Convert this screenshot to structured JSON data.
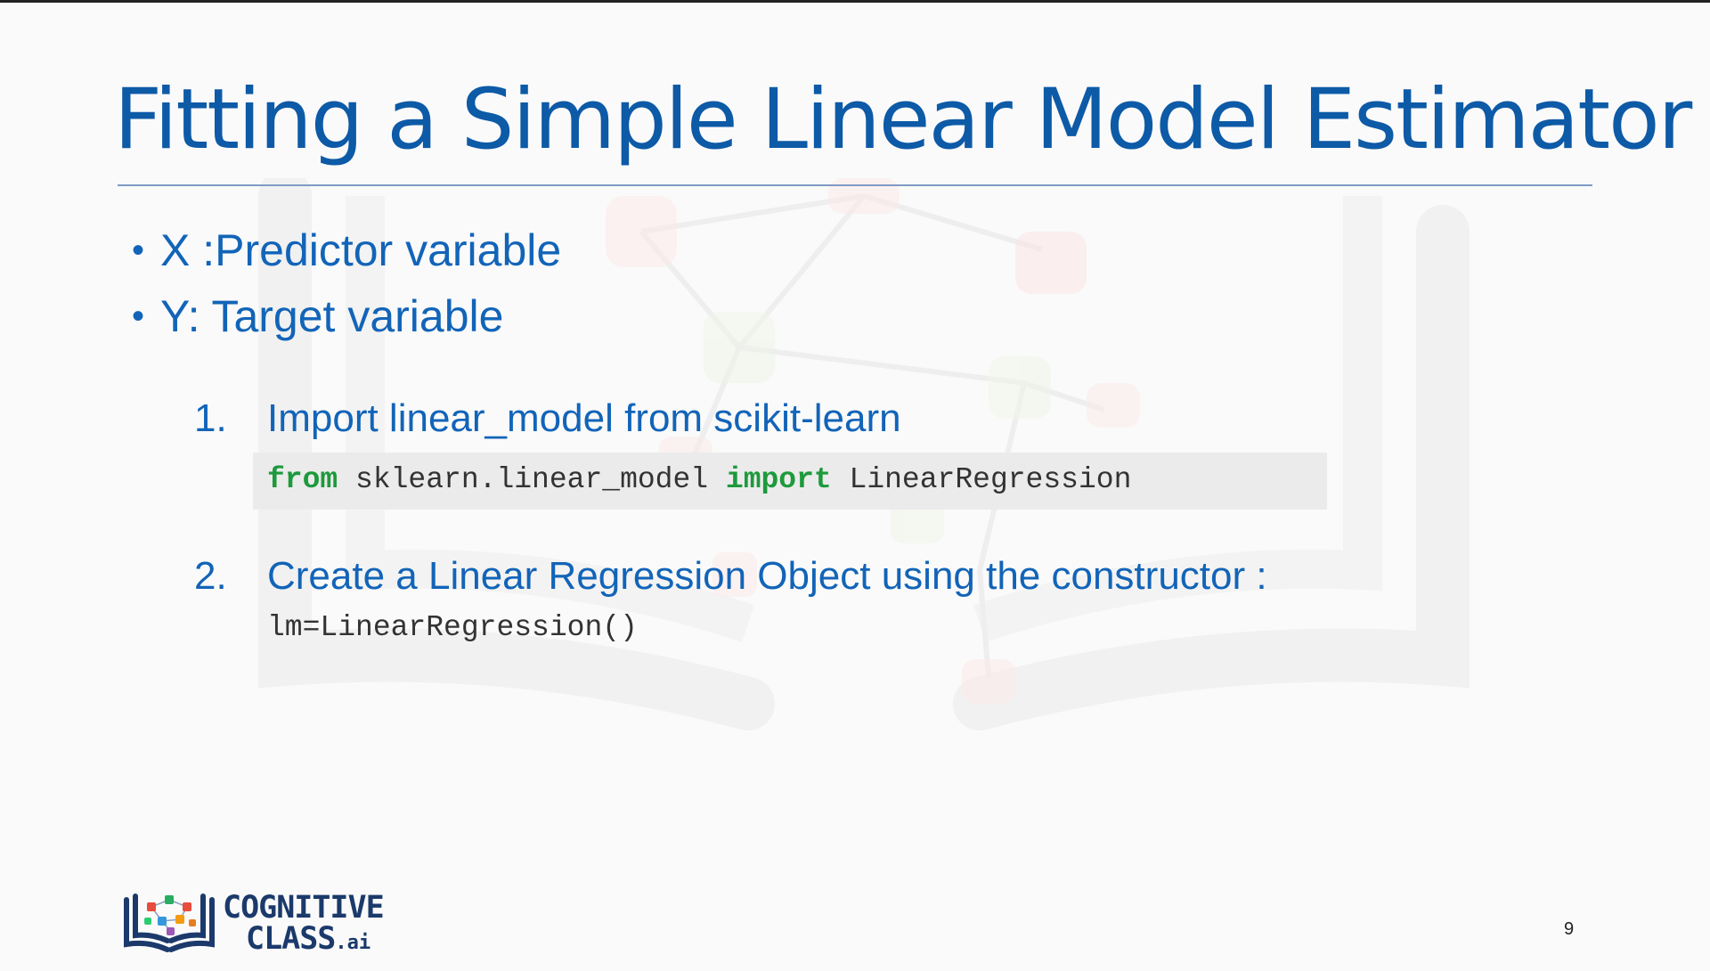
{
  "slide": {
    "title": "Fitting a Simple Linear Model Estimator",
    "bullets": [
      {
        "marker": "•",
        "text": "X :Predictor variable"
      },
      {
        "marker": "•",
        "text": "Y: Target variable"
      }
    ],
    "steps": [
      {
        "number": "1.",
        "text": "Import linear_model from scikit-learn"
      },
      {
        "number": "2.",
        "text": "Create a Linear Regression Object using the constructor :"
      }
    ],
    "code_import": {
      "kw_from": "from",
      "module": " sklearn.linear_model ",
      "kw_import": "import",
      "name": " LinearRegression"
    },
    "code_constructor": "lm=LinearRegression()",
    "page_number": "9"
  },
  "logo": {
    "line1": "COGNITIVE",
    "line2": "CLASS",
    "suffix": ".ai"
  },
  "colors": {
    "title": "#0d5aa7",
    "body_text": "#1264b8",
    "keyword": "#1d9a3c",
    "code_background": "#ebebeb"
  }
}
